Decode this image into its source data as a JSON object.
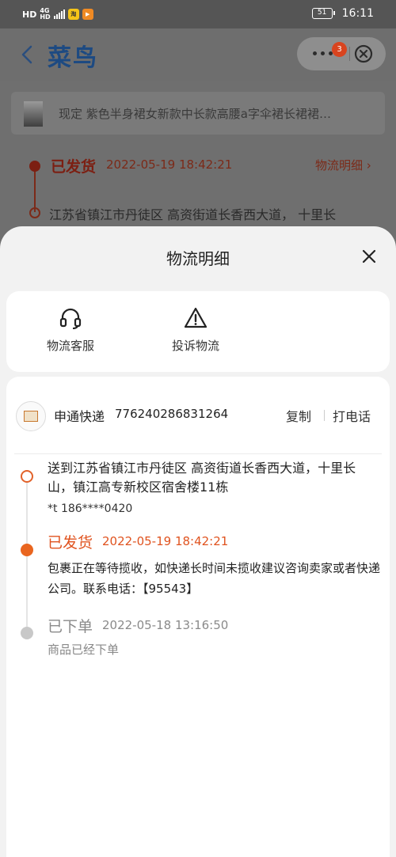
{
  "status_bar": {
    "hd": "HD",
    "network_top": "4G",
    "network_bottom": "HD",
    "app1": "淘",
    "app2": "▶",
    "battery": "51",
    "time": "16:11"
  },
  "header": {
    "brand": "菜鸟",
    "notification_badge": "3"
  },
  "background_page": {
    "product_title": "现定 紫色半身裙女新款中长款高腰a字伞裙长裙裙…",
    "status": "已发货",
    "time": "2022-05-19 18:42:21",
    "detail_link": "物流明细 ›",
    "address_preview": "江苏省镇江市丹徒区 高资街道长香西大道， 十里长"
  },
  "sheet": {
    "title": "物流明细",
    "actions": [
      {
        "label": "物流客服",
        "icon": "headset-icon"
      },
      {
        "label": "投诉物流",
        "icon": "warning-icon"
      }
    ],
    "carrier": {
      "name": "申通快递",
      "tracking_number": "776240286831264",
      "copy": "复制",
      "call": "打电话"
    },
    "timeline": [
      {
        "text": "送到江苏省镇江市丹徒区 高资街道长香西大道，十里长山，镇江高专新校区宿舍楼11栋",
        "contact": "*t 186****0420"
      },
      {
        "status": "已发货",
        "time": "2022-05-19 18:42:21",
        "description": "包裹正在等待揽收，如快递长时间未揽收建议咨询卖家或者快递公司。联系电话：【95543】"
      },
      {
        "status": "已下单",
        "time": "2022-05-18 13:16:50",
        "description": "商品已经下单"
      }
    ]
  },
  "colors": {
    "accent": "#e0531f",
    "brand": "#1d4a82",
    "muted": "#8a8a8a"
  }
}
